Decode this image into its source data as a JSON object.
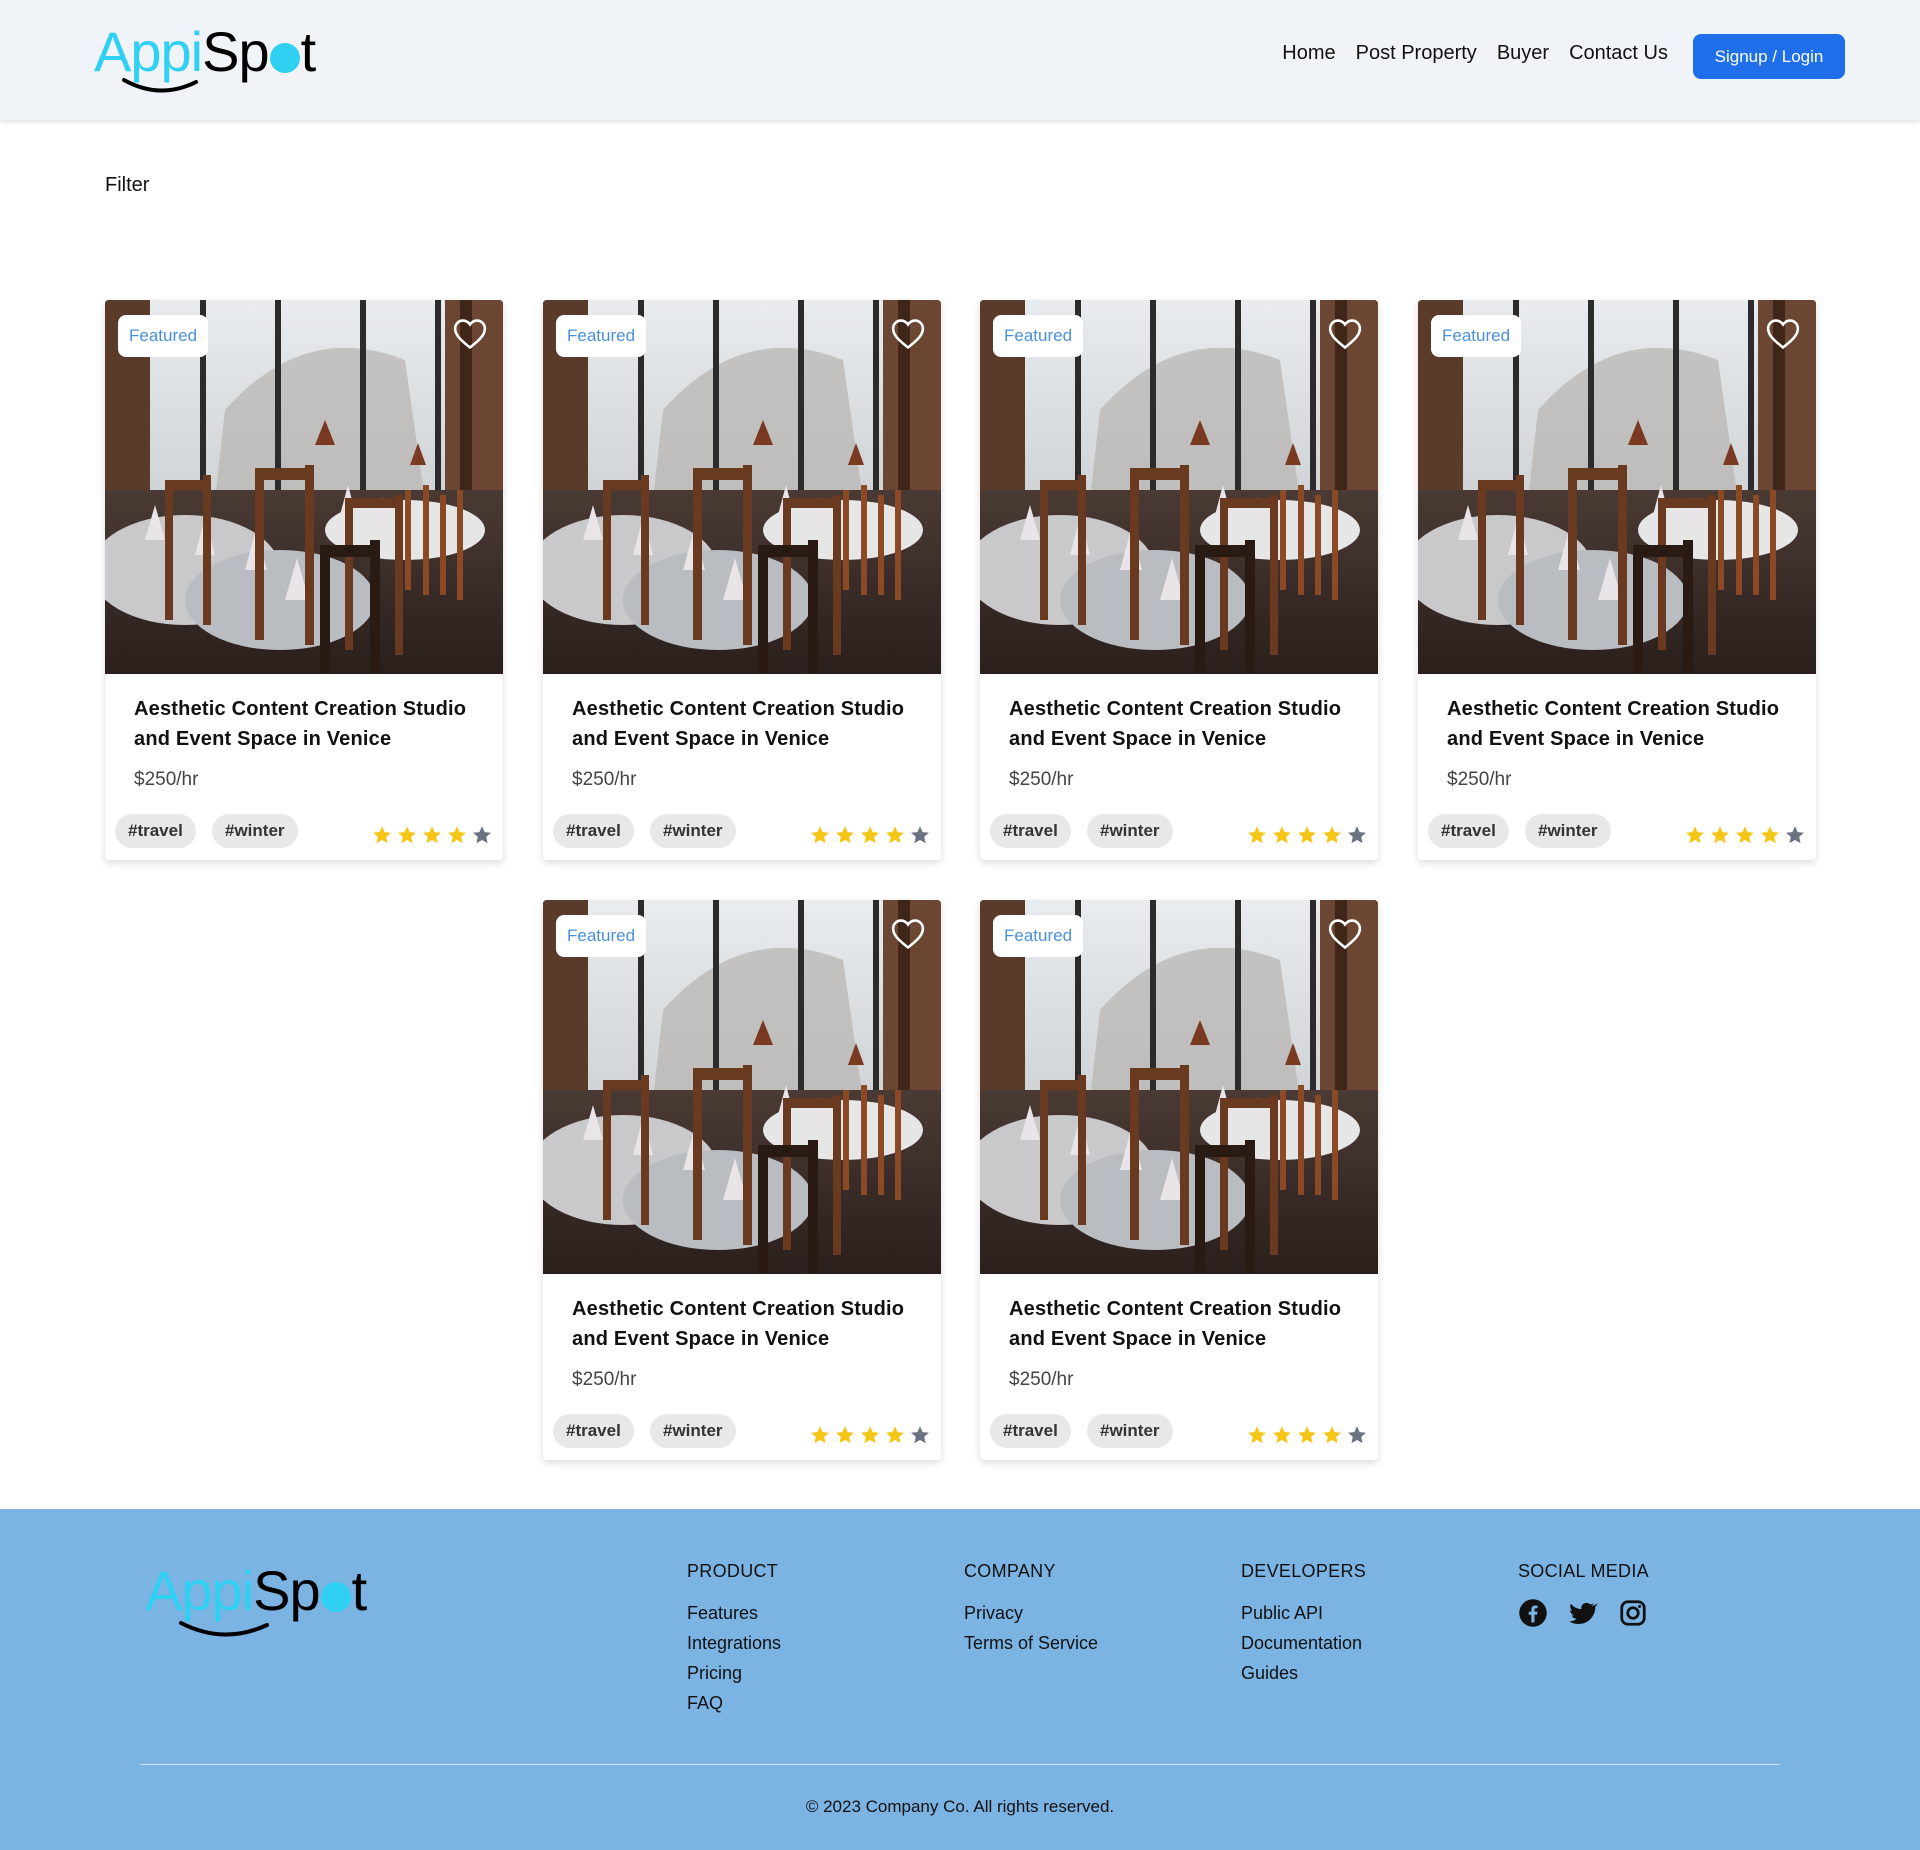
{
  "brand": {
    "logo_part1": "Appi",
    "logo_part2": "Sp",
    "logo_part3": "t",
    "accent_color": "#2fd0f2",
    "primary_button_color": "#1f6feb",
    "footer_color": "#7bb3e3"
  },
  "nav": {
    "items": [
      "Home",
      "Post Property",
      "Buyer",
      "Contact Us"
    ],
    "login_label": "Signup / Login"
  },
  "filter_label": "Filter",
  "listings": [
    {
      "badge": "Featured",
      "title": "Aesthetic Content Creation Studio and Event Space in Venice",
      "price": "$250/hr",
      "tags": [
        "#travel",
        "#winter"
      ],
      "rating": 4,
      "max_rating": 5
    },
    {
      "badge": "Featured",
      "title": "Aesthetic Content Creation Studio and Event Space in Venice",
      "price": "$250/hr",
      "tags": [
        "#travel",
        "#winter"
      ],
      "rating": 4,
      "max_rating": 5
    },
    {
      "badge": "Featured",
      "title": "Aesthetic Content Creation Studio and Event Space in Venice",
      "price": "$250/hr",
      "tags": [
        "#travel",
        "#winter"
      ],
      "rating": 4,
      "max_rating": 5
    },
    {
      "badge": "Featured",
      "title": "Aesthetic Content Creation Studio and Event Space in Venice",
      "price": "$250/hr",
      "tags": [
        "#travel",
        "#winter"
      ],
      "rating": 4,
      "max_rating": 5
    },
    {
      "badge": "Featured",
      "title": "Aesthetic Content Creation Studio and Event Space in Venice",
      "price": "$250/hr",
      "tags": [
        "#travel",
        "#winter"
      ],
      "rating": 4,
      "max_rating": 5
    },
    {
      "badge": "Featured",
      "title": "Aesthetic Content Creation Studio and Event Space in Venice",
      "price": "$250/hr",
      "tags": [
        "#travel",
        "#winter"
      ],
      "rating": 4,
      "max_rating": 5
    }
  ],
  "footer": {
    "columns": [
      {
        "heading": "PRODUCT",
        "items": [
          "Features",
          "Integrations",
          "Pricing",
          "FAQ"
        ]
      },
      {
        "heading": "COMPANY",
        "items": [
          "Privacy",
          "Terms of Service"
        ]
      },
      {
        "heading": "DEVELOPERS",
        "items": [
          "Public API",
          "Documentation",
          "Guides"
        ]
      }
    ],
    "social_heading": "SOCIAL MEDIA",
    "social_icons": [
      "facebook-icon",
      "twitter-icon",
      "instagram-icon"
    ],
    "copyright": "© 2023 Company Co. All rights reserved."
  }
}
